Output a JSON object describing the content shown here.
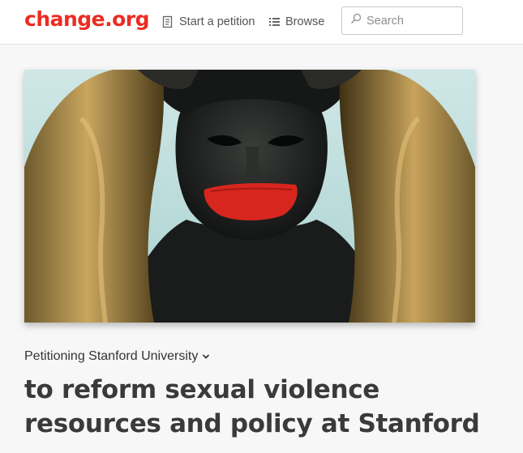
{
  "header": {
    "logo": "change.org",
    "start_petition": "Start a petition",
    "browse": "Browse",
    "search_placeholder": "Search"
  },
  "hero": {
    "image_subject": "bronze statue with red tape over mouth",
    "icon": "hero-image"
  },
  "petition": {
    "petitioning": "Petitioning Stanford University",
    "title": "to reform sexual violence resources and policy at Stanford"
  },
  "colors": {
    "brand": "#ec2c22",
    "text": "#3a3a3a",
    "background": "#f7f7f7"
  },
  "icons": {
    "start_petition": "document-icon",
    "browse": "list-icon",
    "search": "search-icon",
    "dropdown": "chevron-down-icon"
  }
}
